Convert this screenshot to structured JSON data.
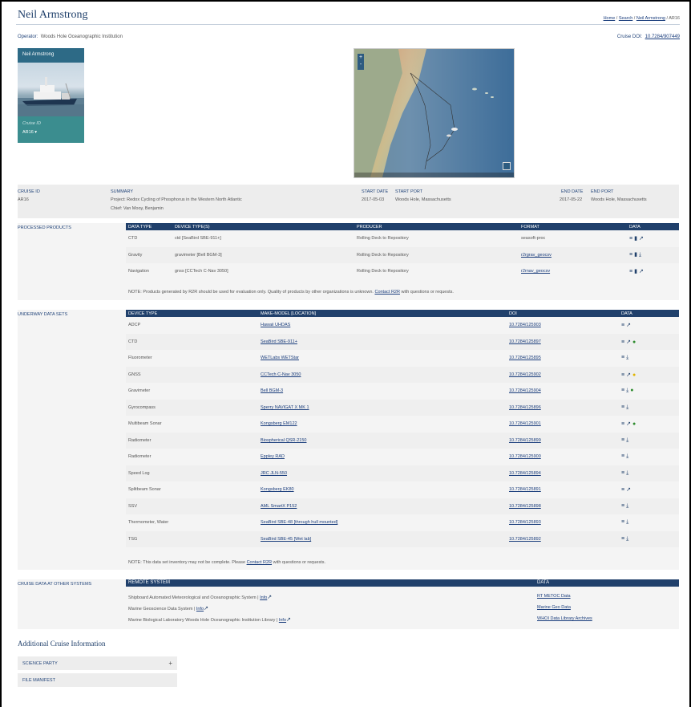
{
  "header": {
    "title": "Neil Armstrong",
    "breadcrumbs": [
      "Home",
      "Search",
      "Neil Armstrong",
      "AR16"
    ],
    "operator_label": "Operator:",
    "operator": "Woods Hole Oceanographic Institution",
    "cruise_doi_label": "Cruise DOI:",
    "cruise_doi": "10.7284/907449"
  },
  "ship_card": {
    "name": "Neil Armstrong",
    "cruise_id_label": "Cruise ID",
    "cruise_id_value": "AR16"
  },
  "map": {
    "zoom_in": "+",
    "zoom_out": "-",
    "fullscreen_icon": "fullscreen-icon"
  },
  "summary": {
    "cruise_id_hdr": "CRUISE ID",
    "cruise_id": "AR16",
    "summary_hdr": "SUMMARY",
    "project": "Project: Redox Cycling of Phosphorus in the Western North Atlantic",
    "chief": "Chief: Van Mooy, Benjamin",
    "start_date_hdr": "START DATE",
    "start_date": "2017-05-03",
    "start_port_hdr": "START PORT",
    "start_port": "Woods Hole, Massachusetts",
    "end_date_hdr": "END DATE",
    "end_date": "2017-05-22",
    "end_port_hdr": "END PORT",
    "end_port": "Woods Hole, Massachusetts"
  },
  "processed": {
    "section_label": "PROCESSED PRODUCTS",
    "columns": [
      "DATA TYPE",
      "DEVICE TYPE(S)",
      "PRODUCER",
      "FORMAT",
      "DATA"
    ],
    "rows": [
      {
        "type": "CTD",
        "device": "ctd [SeaBird SBE-911+]",
        "producer": "Rolling Deck to Repository",
        "format": "seasoft-proc",
        "format_link": false,
        "icons": [
          "list-icon",
          "file-icon",
          "external-link-icon"
        ]
      },
      {
        "type": "Gravity",
        "device": "gravimeter [Bell BGM-3]",
        "producer": "Rolling Deck to Repository",
        "format": "r2rgrav_geocsv",
        "format_link": true,
        "icons": [
          "list-icon",
          "file-icon",
          "download-icon"
        ]
      },
      {
        "type": "Navigation",
        "device": "gnss [CCTech C-Nav 3050]",
        "producer": "Rolling Deck to Repository",
        "format": "r2rnav_geocsv",
        "format_link": true,
        "icons": [
          "list-icon",
          "file-icon",
          "external-link-icon"
        ]
      }
    ],
    "note_prefix": "NOTE: Products generated by R2R should be used for evaluation only. Quality of products by other organizations is unknown.",
    "note_link": "Contact R2R",
    "note_suffix": "with questions or requests."
  },
  "underway": {
    "section_label": "UNDERWAY DATA SETS",
    "columns": [
      "DEVICE TYPE",
      "MAKE-MODEL [LOCATION]",
      "DOI",
      "DATA"
    ],
    "rows": [
      {
        "device": "ADCP",
        "model": "Hawaii UHDAS",
        "doi": "10.7284/125903",
        "icons": [
          "list-icon",
          "external-link-icon"
        ]
      },
      {
        "device": "CTD",
        "model": "SeaBird SBE-911+",
        "doi": "10.7284/125897",
        "icons": [
          "list-icon",
          "external-link-icon",
          "check-icon"
        ]
      },
      {
        "device": "Fluorometer",
        "model": "WETLabs WETStar",
        "doi": "10.7284/125895",
        "icons": [
          "list-icon",
          "download-icon"
        ]
      },
      {
        "device": "GNSS",
        "model": "CCTech C-Nav 3050",
        "doi": "10.7284/125902",
        "icons": [
          "list-icon",
          "external-link-icon",
          "warning-icon"
        ]
      },
      {
        "device": "Gravimeter",
        "model": "Bell BGM-3",
        "doi": "10.7284/125904",
        "icons": [
          "list-icon",
          "download-icon",
          "check-icon"
        ]
      },
      {
        "device": "Gyrocompass",
        "model": "Sperry NAVIGAT X MK 1",
        "doi": "10.7284/125896",
        "icons": [
          "list-icon",
          "download-icon"
        ]
      },
      {
        "device": "Multibeam Sonar",
        "model": "Kongsberg EM122",
        "doi": "10.7284/125901",
        "icons": [
          "list-icon",
          "external-link-icon",
          "check-icon"
        ]
      },
      {
        "device": "Radiometer",
        "model": "Biospherical QSR-2150",
        "doi": "10.7284/125899",
        "icons": [
          "list-icon",
          "download-icon"
        ]
      },
      {
        "device": "Radiometer",
        "model": "Eppley RAD",
        "doi": "10.7284/125900",
        "icons": [
          "list-icon",
          "download-icon"
        ]
      },
      {
        "device": "Speed Log",
        "model": "JRC JLN-550",
        "doi": "10.7284/125894",
        "icons": [
          "list-icon",
          "download-icon"
        ]
      },
      {
        "device": "Splitbeam Sonar",
        "model": "Kongsberg EK80",
        "doi": "10.7284/125891",
        "icons": [
          "list-icon",
          "external-link-icon"
        ]
      },
      {
        "device": "SSV",
        "model": "AML SmartX P152",
        "doi": "10.7284/125898",
        "icons": [
          "list-icon",
          "download-icon"
        ]
      },
      {
        "device": "Thermometer, Water",
        "model": "SeaBird SBE-48 [through hull mounted]",
        "doi": "10.7284/125893",
        "icons": [
          "list-icon",
          "download-icon"
        ]
      },
      {
        "device": "TSG",
        "model": "SeaBird SBE-45 [Wet lab]",
        "doi": "10.7284/125892",
        "icons": [
          "list-icon",
          "download-icon"
        ]
      }
    ],
    "note_prefix": "NOTE: This data set inventory may not be complete. Please",
    "note_link": "Contact R2R",
    "note_suffix": "with questions or requests."
  },
  "other_systems": {
    "section_label": "CRUISE DATA AT OTHER SYSTEMS",
    "columns": [
      "REMOTE SYSTEM",
      "DATA"
    ],
    "info_label": "Info",
    "rows": [
      {
        "system": "Shipboard Automated Meteorological and Oceanographic System",
        "data": "RT METOC Data"
      },
      {
        "system": "Marine Geoscience Data System",
        "data": "Marine Geo Data"
      },
      {
        "system": "Marine Biological Laboratory Woods Hole Oceanographic Institution Library",
        "data": "WHOI Data Library Archives"
      }
    ]
  },
  "additional": {
    "title": "Additional Cruise Information",
    "science_party": "SCIENCE PARTY",
    "science_party_toggle": "+",
    "file_manifest": "FILE MANIFEST"
  },
  "colors": {
    "accent": "#20406b",
    "link": "#1a3d7c",
    "ok": "#2e8b2e",
    "warn": "#e0b400"
  }
}
